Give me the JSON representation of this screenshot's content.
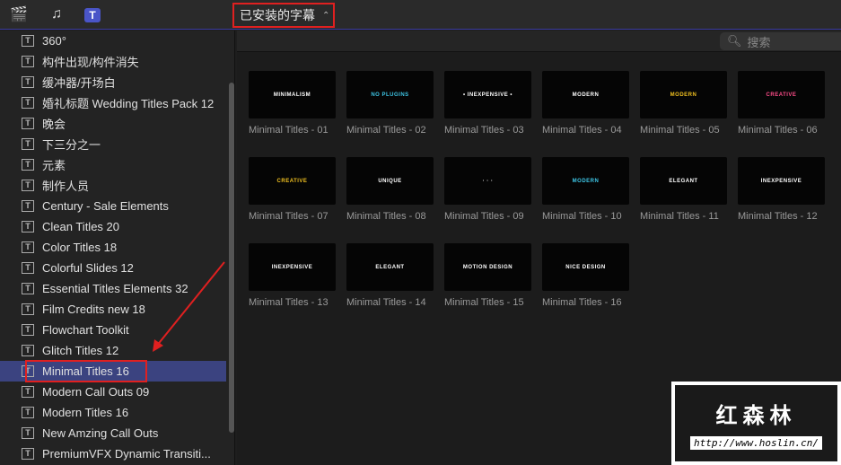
{
  "toolbar": {
    "icons": [
      "clapper-star-icon",
      "music-photo-icon",
      "titles-icon"
    ],
    "dropdown_label": "已安装的字幕",
    "dropdown_arrows": "⌃⌄"
  },
  "sidebar": {
    "items": [
      "360°",
      "构件出现/构件消失",
      "缓冲器/开场白",
      "婚礼标题 Wedding Titles Pack 12",
      "晚会",
      "下三分之一",
      "元素",
      "制作人员",
      "Century - Sale Elements",
      "Clean Titles 20",
      "Color Titles 18",
      "Colorful Slides 12",
      "Essential Titles Elements 32",
      "Film Credits new 18",
      "Flowchart Toolkit",
      "Glitch Titles 12",
      "Minimal Titles 16",
      "Modern Call Outs 09",
      "Modern Titles 16",
      "New Amzing Call Outs",
      "PremiumVFX Dynamic Transiti..."
    ],
    "selected_index": 16
  },
  "search": {
    "placeholder": "搜索"
  },
  "tiles": [
    {
      "caption": "Minimal Titles - 01",
      "thumb": "MINIMALISM",
      "color": "#ffffff"
    },
    {
      "caption": "Minimal Titles - 02",
      "thumb": "NO PLUGINS",
      "color": "#3ec6e6"
    },
    {
      "caption": "Minimal Titles - 03",
      "thumb": "• INEXPENSIVE •",
      "color": "#ffffff"
    },
    {
      "caption": "Minimal Titles - 04",
      "thumb": "MODERN",
      "color": "#ffffff"
    },
    {
      "caption": "Minimal Titles - 05",
      "thumb": "MODERN",
      "color": "#f0c020"
    },
    {
      "caption": "Minimal Titles - 06",
      "thumb": "CREATIVE",
      "color": "#ff4d8a"
    },
    {
      "caption": "Minimal Titles - 07",
      "thumb": "CREATIVE",
      "color": "#f0c020"
    },
    {
      "caption": "Minimal Titles - 08",
      "thumb": "UNIQUE",
      "color": "#ffffff"
    },
    {
      "caption": "Minimal Titles - 09",
      "thumb": "· · ·",
      "color": "#ffffff"
    },
    {
      "caption": "Minimal Titles - 10",
      "thumb": "MODERN",
      "color": "#3ec6e6"
    },
    {
      "caption": "Minimal Titles - 11",
      "thumb": "ELEGANT",
      "color": "#ffffff"
    },
    {
      "caption": "Minimal Titles - 12",
      "thumb": "INEXPENSIVE",
      "color": "#ffffff"
    },
    {
      "caption": "Minimal Titles - 13",
      "thumb": "INEXPENSIVE",
      "color": "#ffffff"
    },
    {
      "caption": "Minimal Titles - 14",
      "thumb": "ELEGANT",
      "color": "#ffffff"
    },
    {
      "caption": "Minimal Titles - 15",
      "thumb": "MOTION DESIGN",
      "color": "#ffffff"
    },
    {
      "caption": "Minimal Titles - 16",
      "thumb": "NICE DESIGN",
      "color": "#ffffff"
    }
  ],
  "watermark": {
    "title": "红森林",
    "url": "http://www.hoslin.cn/"
  }
}
